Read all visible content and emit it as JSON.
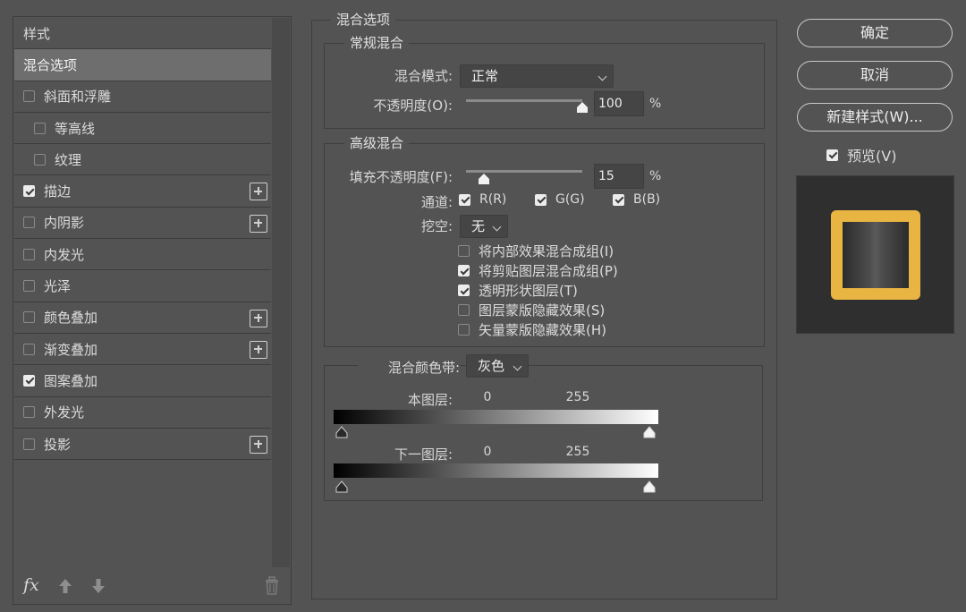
{
  "left_panel": {
    "header": "样式",
    "selected": "混合选项",
    "items": [
      {
        "label": "斜面和浮雕",
        "checked": false,
        "indent": 1,
        "plus": false
      },
      {
        "label": "等高线",
        "checked": false,
        "indent": 2,
        "plus": false
      },
      {
        "label": "纹理",
        "checked": false,
        "indent": 2,
        "plus": false
      },
      {
        "label": "描边",
        "checked": true,
        "indent": 1,
        "plus": true
      },
      {
        "label": "内阴影",
        "checked": false,
        "indent": 1,
        "plus": true
      },
      {
        "label": "内发光",
        "checked": false,
        "indent": 1,
        "plus": false
      },
      {
        "label": "光泽",
        "checked": false,
        "indent": 1,
        "plus": false
      },
      {
        "label": "颜色叠加",
        "checked": false,
        "indent": 1,
        "plus": true
      },
      {
        "label": "渐变叠加",
        "checked": false,
        "indent": 1,
        "plus": true
      },
      {
        "label": "图案叠加",
        "checked": true,
        "indent": 1,
        "plus": false
      },
      {
        "label": "外发光",
        "checked": false,
        "indent": 1,
        "plus": false
      },
      {
        "label": "投影",
        "checked": false,
        "indent": 1,
        "plus": true
      }
    ],
    "footer": {
      "fx_label": "fx"
    }
  },
  "blend_options": {
    "title": "混合选项",
    "general": {
      "title": "常规混合",
      "mode_label": "混合模式:",
      "mode_value": "正常",
      "opacity_label": "不透明度(O):",
      "opacity_value": "100",
      "opacity_unit": "%",
      "opacity_level": 1.0
    },
    "advanced": {
      "title": "高级混合",
      "fill_label": "填充不透明度(F):",
      "fill_value": "15",
      "fill_unit": "%",
      "fill_level": 0.15,
      "channels_label": "通道:",
      "channel_r": "R(R)",
      "channel_g": "G(G)",
      "channel_b": "B(B)",
      "knockout_label": "挖空:",
      "knockout_value": "无",
      "options": [
        {
          "label": "将内部效果混合成组(I)",
          "checked": false
        },
        {
          "label": "将剪贴图层混合成组(P)",
          "checked": true
        },
        {
          "label": "透明形状图层(T)",
          "checked": true
        },
        {
          "label": "图层蒙版隐藏效果(S)",
          "checked": false
        },
        {
          "label": "矢量蒙版隐藏效果(H)",
          "checked": false
        }
      ]
    },
    "blend_if": {
      "label": "混合颜色带:",
      "value": "灰色",
      "this_layer_label": "本图层:",
      "this_layer_min": "0",
      "this_layer_max": "255",
      "underlying_label": "下一图层:",
      "underlying_min": "0",
      "underlying_max": "255"
    }
  },
  "right_panel": {
    "ok": "确定",
    "cancel": "取消",
    "new_style": "新建样式(W)...",
    "preview_label": "预览(V)",
    "preview_checked": true,
    "preview_colors": {
      "stroke": "#e8b442",
      "background": "#2f2f2f"
    }
  }
}
